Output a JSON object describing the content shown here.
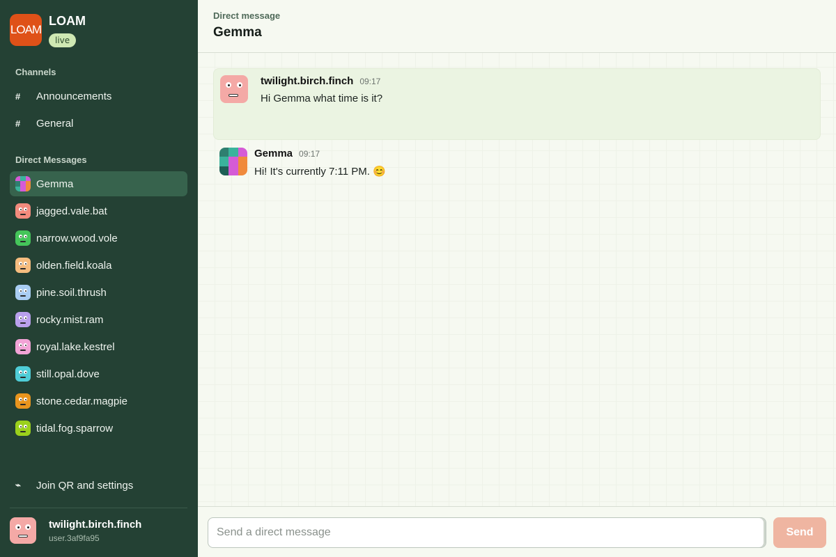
{
  "app": {
    "logo_text": "LOAM",
    "name": "LOAM",
    "status": "live"
  },
  "sidebar": {
    "channels_title": "Channels",
    "channels": [
      {
        "label": "Announcements",
        "icon": "#"
      },
      {
        "label": "General",
        "icon": "#"
      }
    ],
    "dm_title": "Direct Messages",
    "dms": [
      {
        "label": "Gemma",
        "active": true
      },
      {
        "label": "jagged.vale.bat"
      },
      {
        "label": "narrow.wood.vole"
      },
      {
        "label": "olden.field.koala"
      },
      {
        "label": "pine.soil.thrush"
      },
      {
        "label": "rocky.mist.ram"
      },
      {
        "label": "royal.lake.kestrel"
      },
      {
        "label": "still.opal.dove"
      },
      {
        "label": "stone.cedar.magpie"
      },
      {
        "label": "tidal.fog.sparrow"
      }
    ],
    "settings_label": "Join QR and settings",
    "settings_icon": "⌁",
    "user": {
      "name": "twilight.birch.finch",
      "id": "user.3af9fa95"
    }
  },
  "header": {
    "kicker": "Direct message",
    "title": "Gemma"
  },
  "messages": [
    {
      "author": "twilight.birch.finch",
      "time": "09:17",
      "text": "Hi Gemma what time is it?"
    },
    {
      "author": "Gemma",
      "time": "09:17",
      "text": "Hi! It's currently 7:11 PM. 😊"
    }
  ],
  "composer": {
    "placeholder": "Send a direct message",
    "send_label": "Send"
  },
  "colors": {
    "sidebar": "#244134",
    "accent": "#df5118",
    "send": "#efb5a1",
    "highlight": "#ebf4e2"
  }
}
